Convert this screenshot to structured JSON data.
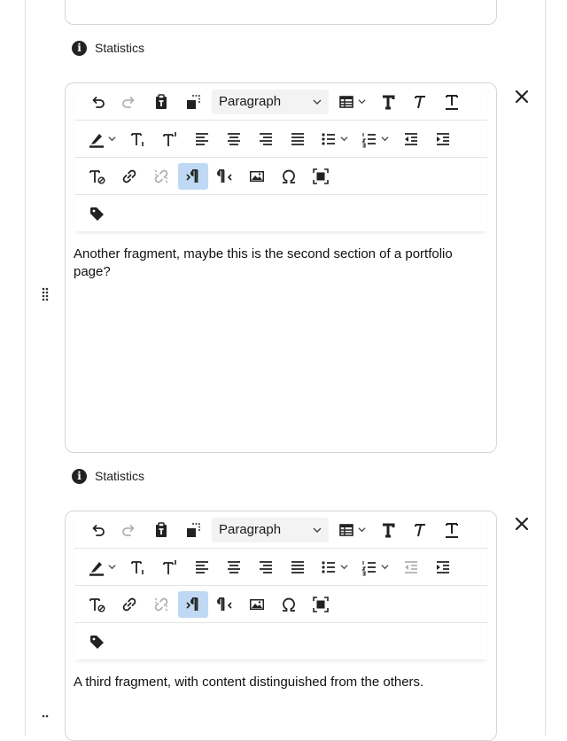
{
  "stats_label": "Statistics",
  "info_glyph": "i",
  "select": {
    "label": "Paragraph",
    "icon": "chevron-down-icon"
  },
  "editors": [
    {
      "content": "Another fragment, maybe this is the second section of a portfolio page?"
    },
    {
      "content": "A third fragment, with content distinguished from the others."
    }
  ],
  "icons": {
    "row1": [
      "undo-icon",
      "redo-icon",
      "paste-as-text-icon",
      "copy-format-icon",
      "paragraph-select",
      "table-icon",
      "bold-icon",
      "italic-icon",
      "underline-icon"
    ],
    "row2": [
      "highlight-color-icon",
      "subscript-icon",
      "superscript-icon",
      "align-left-icon",
      "align-center-icon",
      "align-right-icon",
      "align-justify-icon",
      "bullet-list-icon",
      "numbered-list-icon",
      "outdent-icon",
      "indent-icon"
    ],
    "row3": [
      "clear-format-icon",
      "link-icon",
      "unlink-icon",
      "ltr-icon",
      "rtl-icon",
      "image-icon",
      "special-char-icon",
      "fullscreen-icon"
    ],
    "row4": [
      "tag-icon"
    ]
  },
  "colors": {
    "active_button": "#bfd9f4",
    "border": "#d6d6d6",
    "text": "#111111"
  }
}
